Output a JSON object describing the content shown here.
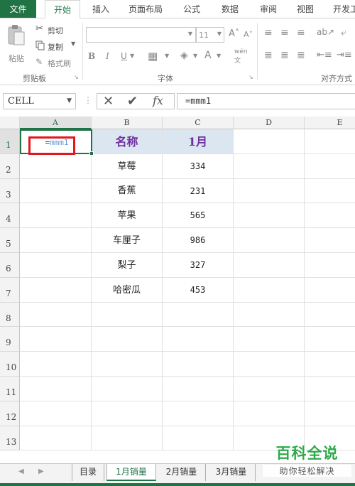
{
  "ribbon_tabs": [
    "文件",
    "开始",
    "插入",
    "页面布局",
    "公式",
    "数据",
    "审阅",
    "视图",
    "开发工"
  ],
  "clipboard": {
    "paste": "粘贴",
    "cut": "剪切",
    "copy": "复制",
    "format_painter": "格式刷",
    "group_label": "剪贴板"
  },
  "font_group": {
    "font_size": "11",
    "bold": "B",
    "italic": "I",
    "underline": "U",
    "group_label": "字体"
  },
  "alignment_group": {
    "group_label": "对齐方式"
  },
  "formula_bar": {
    "name_box": "CELL",
    "cancel_symbol": "✕",
    "enter_symbol": "✔",
    "fx_symbol": "fx",
    "formula": "=mmm1"
  },
  "columns": [
    "A",
    "B",
    "C",
    "D",
    "E"
  ],
  "rows": [
    "1",
    "2",
    "3",
    "4",
    "5",
    "6",
    "7",
    "8",
    "9",
    "10",
    "11",
    "12",
    "13"
  ],
  "active_cell": {
    "prefix": "=",
    "ref": "mmm1"
  },
  "table": {
    "headers": [
      "名称",
      "1月"
    ],
    "rows": [
      [
        "草莓",
        "334"
      ],
      [
        "香蕉",
        "231"
      ],
      [
        "苹果",
        "565"
      ],
      [
        "车厘子",
        "986"
      ],
      [
        "梨子",
        "327"
      ],
      [
        "哈密瓜",
        "453"
      ]
    ]
  },
  "sheet_tabs": [
    "目录",
    "1月销量",
    "2月销量",
    "3月销量"
  ],
  "active_sheet": "1月销量",
  "watermark": {
    "title": "百科全说",
    "subtitle": "助你轻松解决"
  },
  "colors": {
    "excel_green": "#217346",
    "header_fill": "#dce6f1",
    "header_text": "#7030a0",
    "highlight": "#e0191f",
    "watermark_green": "#2eaa4a"
  }
}
